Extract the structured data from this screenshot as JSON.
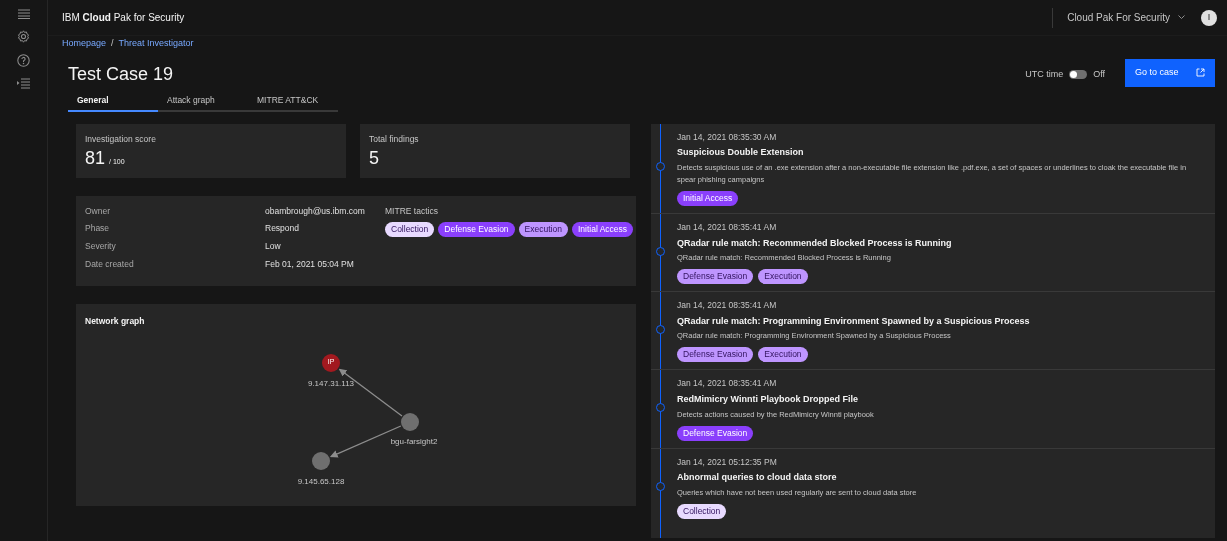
{
  "header": {
    "brand_prefix": "IBM",
    "brand_bold": "Cloud",
    "brand_suffix": "Pak for Security",
    "switcher": "Cloud Pak For Security",
    "avatar": "I"
  },
  "breadcrumb": [
    "Homepage",
    "Threat Investigator"
  ],
  "breadcrumb_separator": "/",
  "title": "Test Case 19",
  "utc_toggle": {
    "label": "UTC time",
    "on": false,
    "state_text": "Off"
  },
  "go_button": "Go to case",
  "tabs": [
    {
      "label": "General",
      "selected": true
    },
    {
      "label": "Attack graph",
      "selected": false
    },
    {
      "label": "MITRE ATT&CK",
      "selected": false
    }
  ],
  "score": {
    "label": "Investigation score",
    "value": "81",
    "max": "/ 100"
  },
  "findings": {
    "label": "Total findings",
    "value": "5"
  },
  "details": [
    {
      "label": "Owner",
      "value": "obambrough@us.ibm.com"
    },
    {
      "label": "Phase",
      "value": "Respond"
    },
    {
      "label": "Severity",
      "value": "Low"
    },
    {
      "label": "Date created",
      "value": "Feb 01, 2021 05:04 PM"
    }
  ],
  "mitre_tactics": {
    "label": "MITRE tactics",
    "tags": [
      {
        "label": "Collection",
        "color": "#e8daff"
      },
      {
        "label": "Defense Evasion",
        "color": "#8a3ffc"
      },
      {
        "label": "Execution",
        "color": "#be95ff"
      },
      {
        "label": "Initial Access",
        "color": "#8a3ffc"
      }
    ]
  },
  "network_graph": {
    "title": "Network graph",
    "nodes": [
      {
        "kind": "ip",
        "icon_text": "IP",
        "label": "9.147.31.113"
      },
      {
        "kind": "host",
        "label": "bgu-farsight2"
      },
      {
        "kind": "host",
        "label": "9.145.65.128"
      }
    ]
  },
  "timeline": [
    {
      "time": "Jan 14, 2021 08:35:30 AM",
      "title": "Suspicious Double Extension",
      "description": "Detects suspicious use of an .exe extension after a non-executable file extension like .pdf.exe, a set of spaces or underlines to cloak the executable file in spear phishing campaigns",
      "tags": [
        {
          "label": "Initial Access",
          "color": "#8a3ffc"
        }
      ]
    },
    {
      "time": "Jan 14, 2021 08:35:41 AM",
      "title": "QRadar rule match: Recommended Blocked Process is Running",
      "description": "QRadar rule match: Recommended Blocked Process is Running",
      "tags": [
        {
          "label": "Defense Evasion",
          "color": "#be95ff"
        },
        {
          "label": "Execution",
          "color": "#be95ff"
        }
      ]
    },
    {
      "time": "Jan 14, 2021 08:35:41 AM",
      "title": "QRadar rule match: Programming Environment Spawned by a Suspicious Process",
      "description": "QRadar rule match: Programming Environment Spawned by a Suspicious Process",
      "tags": [
        {
          "label": "Defense Evasion",
          "color": "#be95ff"
        },
        {
          "label": "Execution",
          "color": "#be95ff"
        }
      ]
    },
    {
      "time": "Jan 14, 2021 08:35:41 AM",
      "title": "RedMimicry Winnti Playbook Dropped File",
      "description": "Detects actions caused by the RedMimicry Winnti playbook",
      "tags": [
        {
          "label": "Defense Evasion",
          "color": "#8a3ffc"
        }
      ]
    },
    {
      "time": "Jan 14, 2021 05:12:35 PM",
      "title": "Abnormal queries to cloud data store",
      "description": "Queries which have not been used regularly are sent to cloud data store",
      "tags": [
        {
          "label": "Collection",
          "color": "#e8daff"
        }
      ]
    }
  ]
}
